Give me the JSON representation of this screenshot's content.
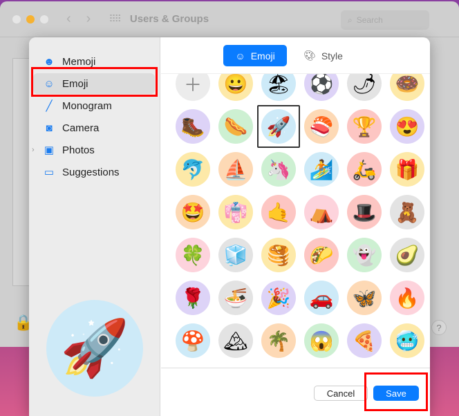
{
  "window": {
    "title": "Users & Groups",
    "search_placeholder": "Search"
  },
  "sidebar": {
    "items": [
      {
        "label": "Memoji",
        "icon": "memoji-icon",
        "glyph": "☻"
      },
      {
        "label": "Emoji",
        "icon": "smiley-icon",
        "glyph": "☺"
      },
      {
        "label": "Monogram",
        "icon": "pencil-icon",
        "glyph": "╱"
      },
      {
        "label": "Camera",
        "icon": "camera-icon",
        "glyph": "◙"
      },
      {
        "label": "Photos",
        "icon": "photos-icon",
        "glyph": "▣"
      },
      {
        "label": "Suggestions",
        "icon": "folder-icon",
        "glyph": "▭"
      }
    ],
    "selected": "Emoji"
  },
  "preview": {
    "emoji": "🚀"
  },
  "tabs": [
    {
      "label": "Emoji",
      "active": true
    },
    {
      "label": "Style",
      "active": false
    }
  ],
  "emoji_grid": [
    [
      [
        "＋",
        "#ececec"
      ],
      [
        "😀",
        "#fde9a8"
      ],
      [
        "🏖",
        "#cdeaf8"
      ],
      [
        "⚽",
        "#ddd3f7"
      ],
      [
        "🌶",
        "#e3e3e3"
      ],
      [
        "🍩",
        "#fde9a8"
      ]
    ],
    [
      [
        "🥾",
        "#ddd3f7"
      ],
      [
        "🌭",
        "#cdf0d2"
      ],
      [
        "🚀",
        "#cdeaf8"
      ],
      [
        "🍣",
        "#fdd9b5"
      ],
      [
        "🏆",
        "#fdc6c3"
      ],
      [
        "😍",
        "#ddd3f7"
      ]
    ],
    [
      [
        "🐬",
        "#fde9a8"
      ],
      [
        "⛵",
        "#fdd9b5"
      ],
      [
        "🦄",
        "#cdf0d2"
      ],
      [
        "🏄",
        "#cdeaf8"
      ],
      [
        "🛵",
        "#fdc6c3"
      ],
      [
        "🎁",
        "#fde9a8"
      ]
    ],
    [
      [
        "🤩",
        "#fdd9b5"
      ],
      [
        "👘",
        "#fde9a8"
      ],
      [
        "🤙",
        "#fdc6c3"
      ],
      [
        "⛺",
        "#fdd3dc"
      ],
      [
        "🎩",
        "#fdc6c3"
      ],
      [
        "🧸",
        "#e3e3e3"
      ]
    ],
    [
      [
        "🍀",
        "#fdd3dc"
      ],
      [
        "🧊",
        "#e3e3e3"
      ],
      [
        "🥞",
        "#fde9a8"
      ],
      [
        "🌮",
        "#fdc6c3"
      ],
      [
        "👻",
        "#cdf0d2"
      ],
      [
        "🥑",
        "#e3e3e3"
      ]
    ],
    [
      [
        "🌹",
        "#ddd3f7"
      ],
      [
        "🍜",
        "#e3e3e3"
      ],
      [
        "🎉",
        "#ddd3f7"
      ],
      [
        "🚗",
        "#cdeaf8"
      ],
      [
        "🦋",
        "#fdd9b5"
      ],
      [
        "🔥",
        "#fdd3dc"
      ]
    ],
    [
      [
        "🍄",
        "#cdeaf8"
      ],
      [
        "🏔",
        "#e3e3e3"
      ],
      [
        "🌴",
        "#fdd9b5"
      ],
      [
        "😱",
        "#cdf0d2"
      ],
      [
        "🍕",
        "#ddd3f7"
      ],
      [
        "🥶",
        "#fde9a8"
      ]
    ],
    [
      [
        "",
        "#e3e3e3"
      ],
      [
        "",
        "#fdc6c3"
      ],
      [
        "",
        "#fde9a8"
      ],
      [
        "",
        "#fdd9b5"
      ],
      [
        "",
        "#fdd3dc"
      ],
      [
        "",
        "#fdc6c3"
      ]
    ]
  ],
  "selected_emoji": "🚀",
  "footer": {
    "cancel": "Cancel",
    "save": "Save"
  },
  "colors": {
    "accent": "#0a7cff",
    "highlight": "#ff0000"
  }
}
